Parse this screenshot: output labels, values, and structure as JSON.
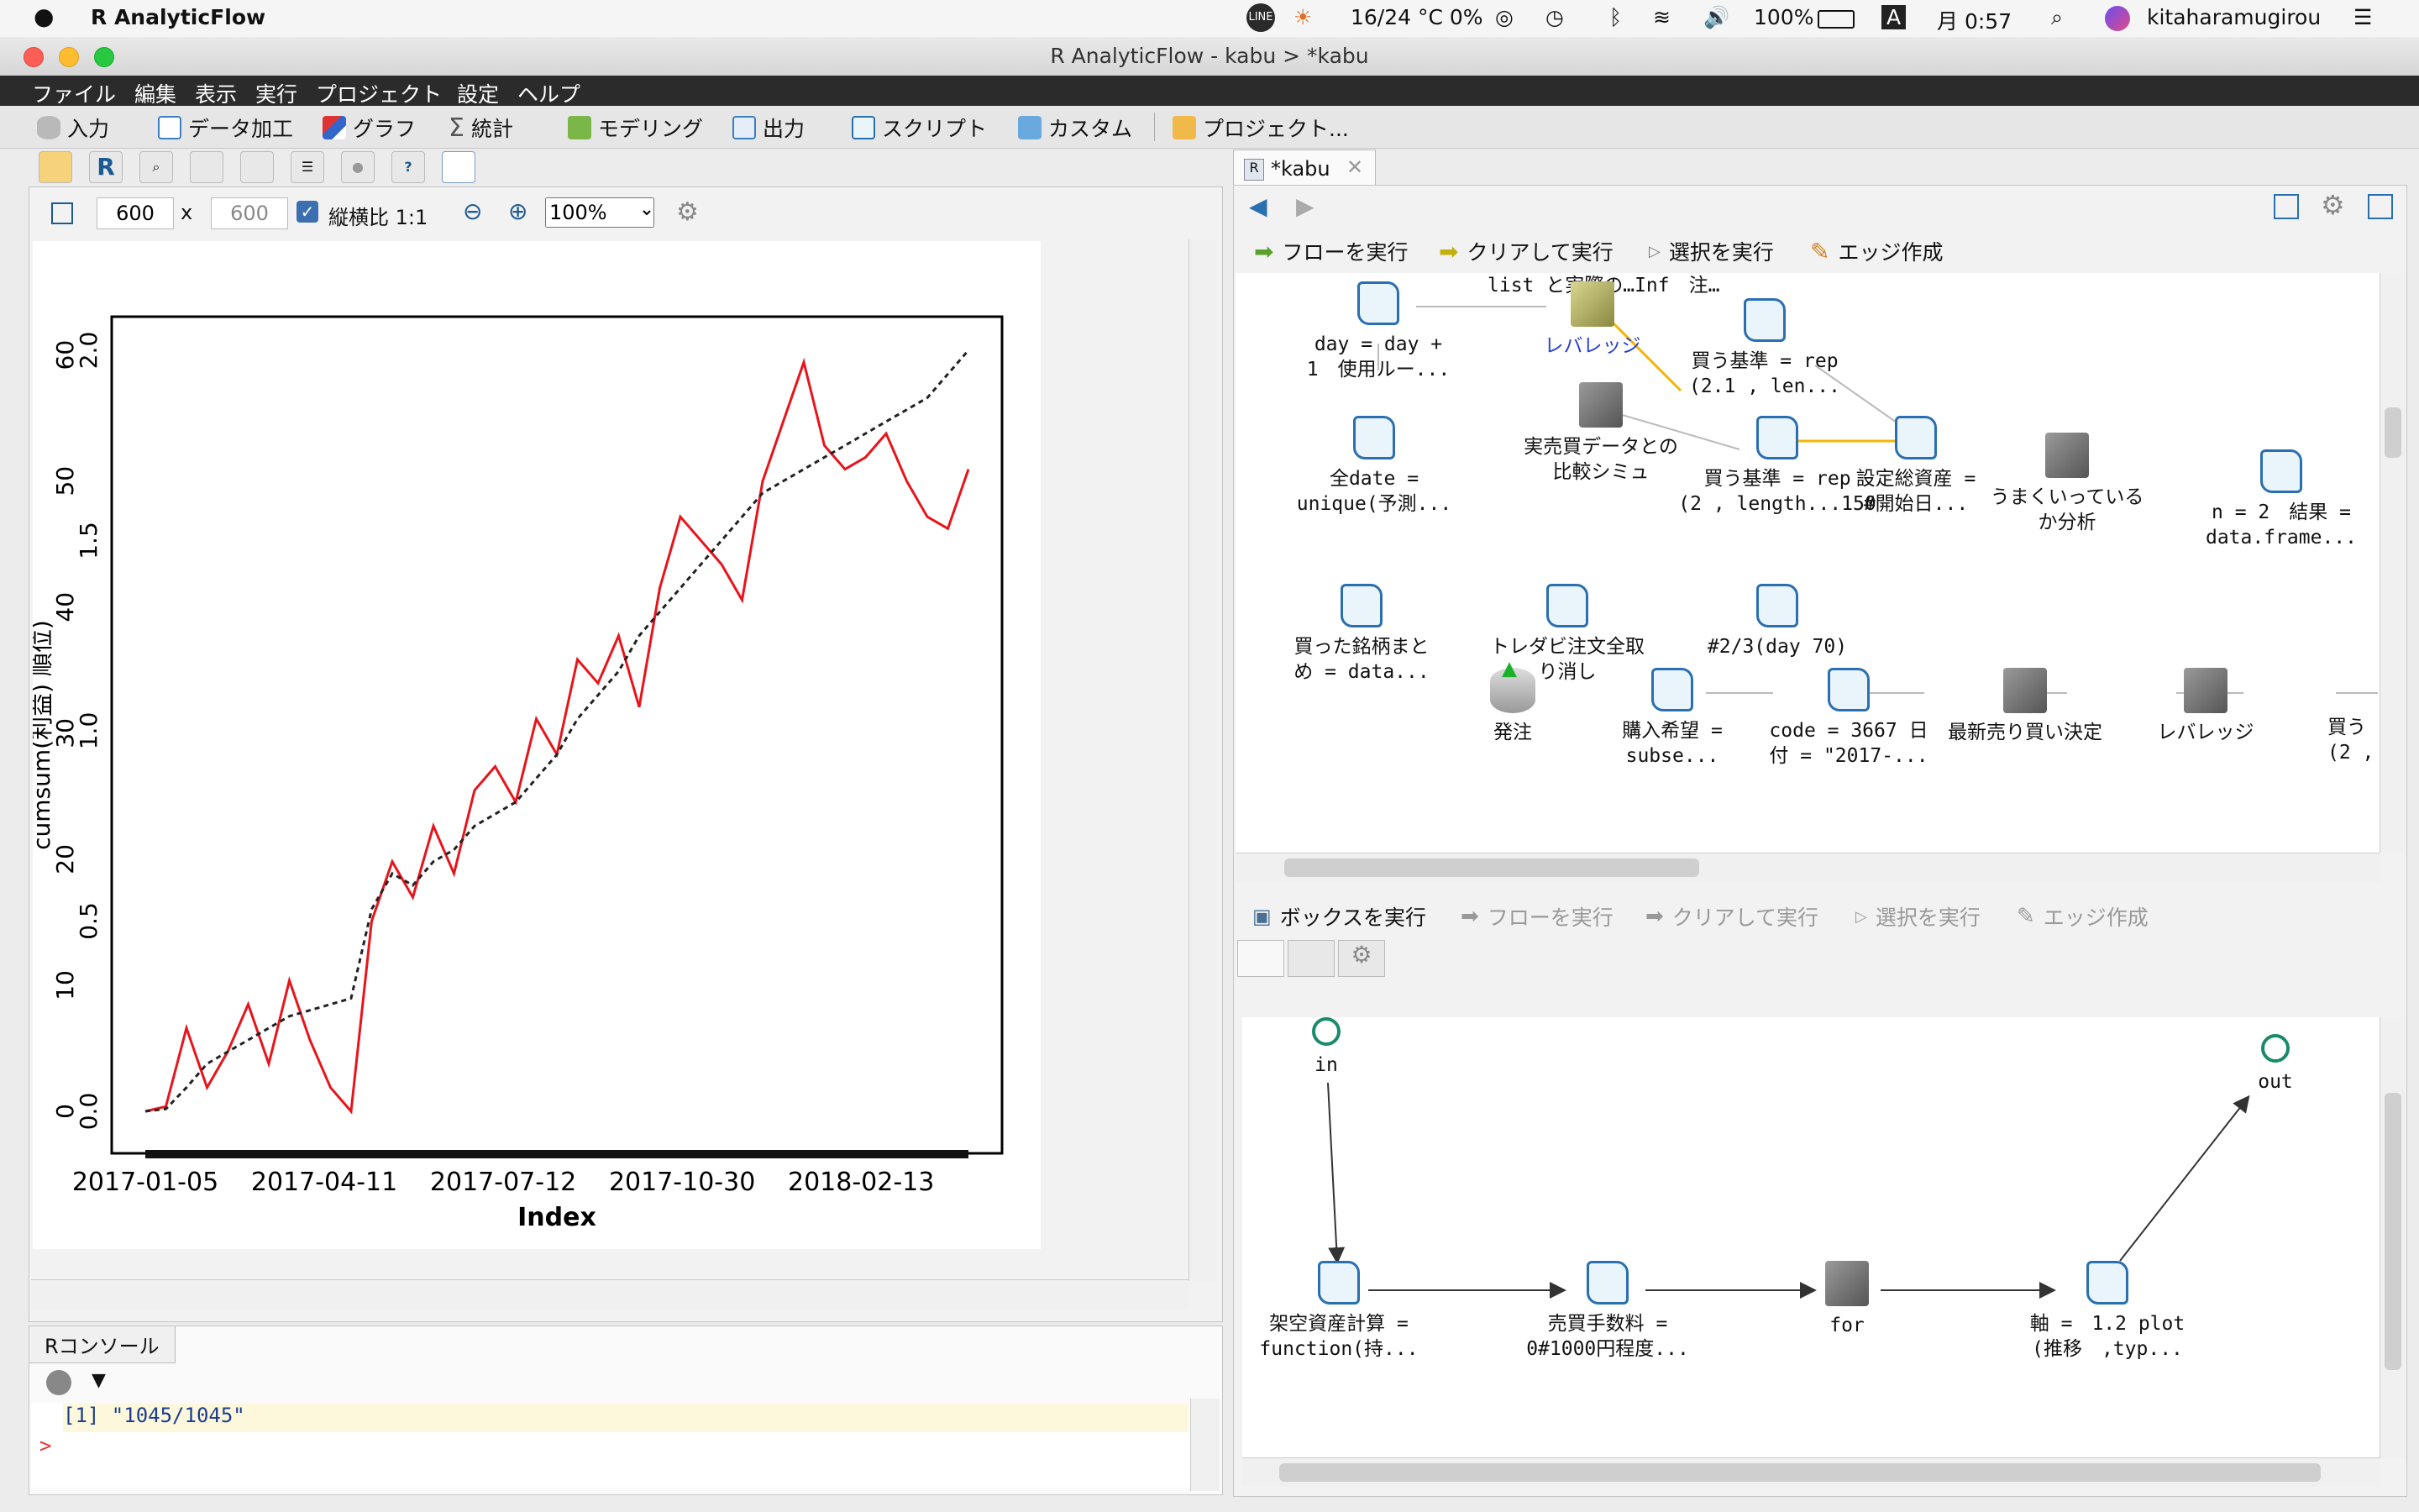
{
  "mac_menubar": {
    "app_name": "R AnalyticFlow",
    "weather": "16/24 °C 0%",
    "battery": "100%",
    "input_mode": "A",
    "clock": "月 0:57",
    "user": "kitaharamugirou"
  },
  "window": {
    "title": "R AnalyticFlow  -  kabu > *kabu"
  },
  "app_menu": [
    "ファイル",
    "編集",
    "表示",
    "実行",
    "プロジェクト",
    "設定",
    "ヘルプ"
  ],
  "toolbar": [
    "入力",
    "データ加工",
    "グラフ",
    "統計",
    "モデリング",
    "出力",
    "スクリプト",
    "カスタム",
    "プロジェクト..."
  ],
  "plot_panel": {
    "width_value": "600",
    "x_label": "x",
    "height_value": "600",
    "aspect_label": "縦横比 1:1",
    "zoom": "100%",
    "aspect_checked": true
  },
  "chart_data": {
    "type": "line",
    "xlabel": "Index",
    "ylabel": "cumsum(利益) 順位)",
    "x_ticks": [
      "2017-01-05",
      "2017-04-11",
      "2017-07-12",
      "2017-10-30",
      "2018-02-13"
    ],
    "y_ticks_left_outer": [
      "0.0",
      "0.5",
      "1.0",
      "1.5",
      "2.0"
    ],
    "y_ticks_left_inner": [
      "0",
      "10",
      "20",
      "30",
      "40",
      "50",
      "60"
    ],
    "series": [
      {
        "color": "#e8141b",
        "style": "solid",
        "values": [
          0,
          0.4,
          7,
          2,
          5,
          9,
          4,
          11,
          6,
          2,
          0,
          16,
          21,
          18,
          24,
          20,
          27,
          29,
          26,
          33,
          30,
          38,
          36,
          40,
          34,
          44,
          50,
          48,
          46,
          43,
          53,
          58,
          63,
          56,
          54,
          55,
          57,
          53,
          50,
          49,
          54
        ]
      },
      {
        "color": "#222222",
        "style": "dashed",
        "values": [
          0,
          0.2,
          2,
          4,
          5,
          6,
          7,
          8,
          8.5,
          9,
          9.5,
          17,
          20,
          19,
          21,
          22,
          24,
          25,
          26,
          28,
          30,
          33,
          35,
          37,
          40,
          42,
          44,
          46,
          48,
          50,
          52,
          53,
          54,
          55,
          56,
          57,
          58,
          59,
          60,
          62,
          64
        ]
      }
    ]
  },
  "console": {
    "tab": "Rコンソール",
    "output_line": "[1] \"1045/1045\"",
    "prompt": ">"
  },
  "editor": {
    "tab": "*kabu",
    "flow_buttons": [
      "フローを実行",
      "クリアして実行",
      "選択を実行",
      "エッジ作成"
    ],
    "nodes": [
      {
        "label": "list と実際の…Inf　注…"
      },
      {
        "label": "day = day +\n1　使用ルー..."
      },
      {
        "label": "レバレッジ"
      },
      {
        "label": "買う基準 = rep\n(2.1 , len..."
      },
      {
        "label": "実売買データとの\n比較シミュ"
      },
      {
        "label": "買う基準 = rep\n(2 , length...150"
      },
      {
        "label": "設定総資産 =\n#開始日..."
      },
      {
        "label": "うまくいっている\nか分析"
      },
      {
        "label": "全date =\nunique(予測..."
      },
      {
        "label": "n = 2　結果 =\ndata.frame..."
      },
      {
        "label": "買った銘柄まと\nめ = data..."
      },
      {
        "label": "トレダビ注文全取\nり消し"
      },
      {
        "label": "#2/3(day 70)"
      },
      {
        "label": "発注"
      },
      {
        "label": "購入希望 =\nsubse..."
      },
      {
        "label": "code = 3667 日\n付 = \"2017-..."
      },
      {
        "label": "最新売り買い決定"
      },
      {
        "label": "レバレッジ"
      },
      {
        "label": "買う\n(2 ,"
      }
    ]
  },
  "box_panel": {
    "buttons": [
      "ボックスを実行",
      "フローを実行",
      "クリアして実行",
      "選択を実行",
      "エッジ作成"
    ],
    "nodes": [
      {
        "label": "in"
      },
      {
        "label": "out"
      },
      {
        "label": "架空資産計算 =\nfunction(持..."
      },
      {
        "label": "売買手数料 =\n0#1000円程度..."
      },
      {
        "label": "for"
      },
      {
        "label": "軸 =　1.2 plot\n(推移　,typ..."
      }
    ]
  }
}
